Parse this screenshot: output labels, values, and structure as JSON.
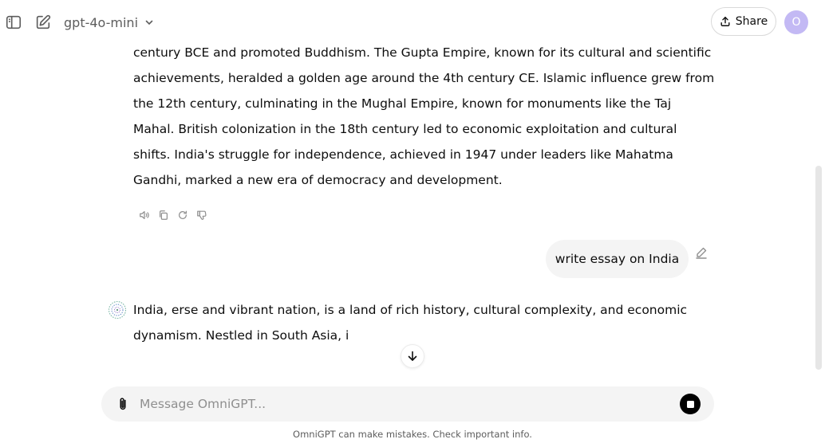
{
  "header": {
    "model_name": "gpt-4o-mini",
    "share_label": "Share",
    "avatar_initial": "O"
  },
  "conversation": {
    "previous_response": "century BCE and promoted Buddhism. The Gupta Empire, known for its cultural and scientific achievements, heralded a golden age around the 4th century CE. Islamic influence grew from the 12th century, culminating in the Mughal Empire, known for monuments like the Taj Mahal. British colonization in the 18th century led to economic exploitation and cultural shifts. India's struggle for independence, achieved in 1947 under leaders like Mahatma Gandhi, marked a new era of democracy and development.",
    "user_message": "write essay on India",
    "current_response": "India, erse and vibrant nation, is a land of rich history, cultural complexity, and economic dynamism. Nestled in South Asia, i"
  },
  "composer": {
    "placeholder": "Message OmniGPT..."
  },
  "footer": {
    "disclaimer": "OmniGPT can make mistakes. Check important info."
  },
  "icons": {
    "sidebar_toggle": "sidebar-icon",
    "new_chat": "edit-icon",
    "model_dropdown": "chevron-down-icon",
    "share": "upload-icon",
    "read_aloud": "speaker-icon",
    "copy": "copy-icon",
    "regenerate": "refresh-icon",
    "dislike": "thumbs-down-icon",
    "edit_message": "pencil-icon",
    "assistant_logo": "assistant-logo-icon",
    "scroll_down": "arrow-down-icon",
    "attach": "paperclip-icon",
    "stop": "stop-icon"
  },
  "colors": {
    "user_bubble": "#f4f4f4",
    "composer": "#f4f4f4",
    "avatar": "#c3b9f4"
  }
}
